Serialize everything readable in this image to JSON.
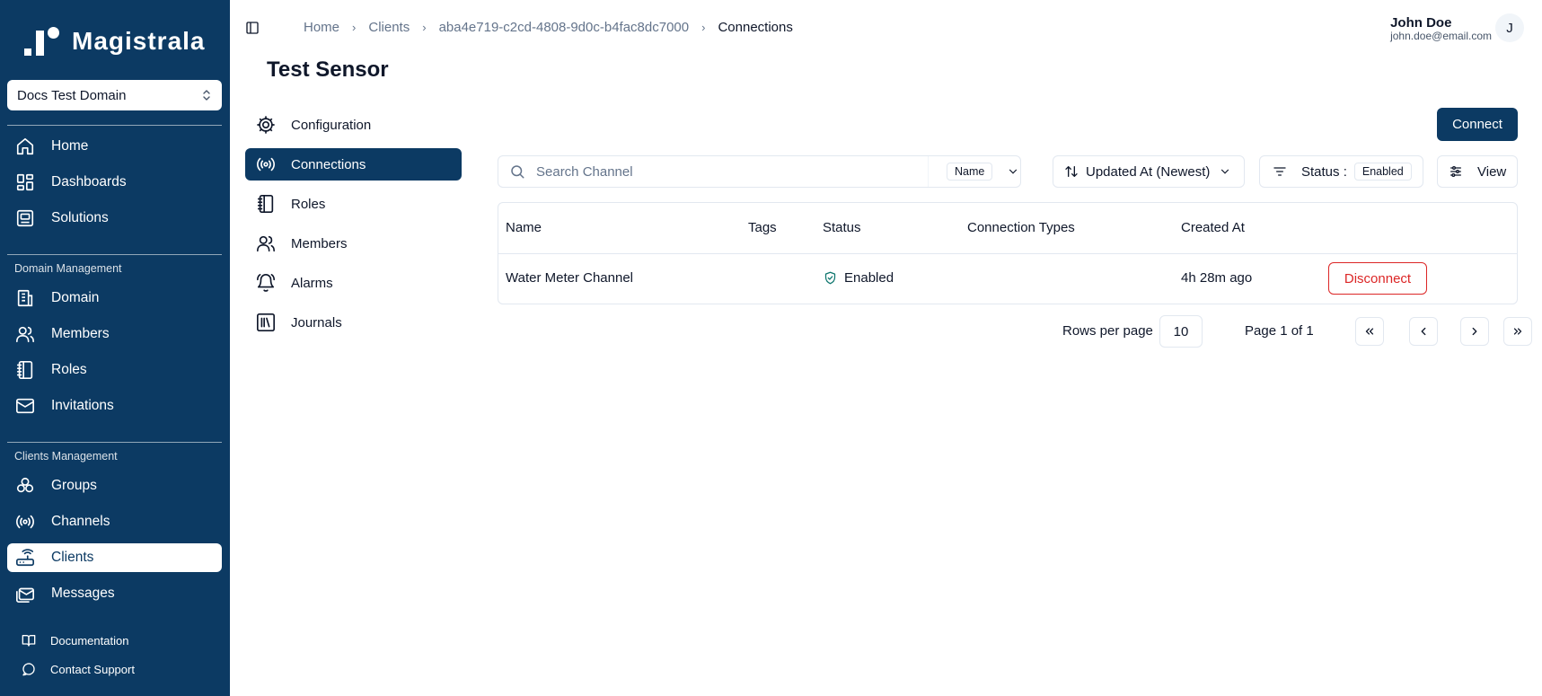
{
  "app": {
    "brand": "Magistrala",
    "domain_selector": "Docs Test Domain"
  },
  "sidebar": {
    "main_items": [
      {
        "label": "Home",
        "icon": "home-icon"
      },
      {
        "label": "Dashboards",
        "icon": "dashboard-icon"
      },
      {
        "label": "Solutions",
        "icon": "solutions-icon"
      }
    ],
    "domain_section_label": "Domain Management",
    "domain_items": [
      {
        "label": "Domain",
        "icon": "building-icon"
      },
      {
        "label": "Members",
        "icon": "users-icon"
      },
      {
        "label": "Roles",
        "icon": "notebook-icon"
      },
      {
        "label": "Invitations",
        "icon": "mail-icon"
      }
    ],
    "clients_section_label": "Clients Management",
    "clients_items": [
      {
        "label": "Groups",
        "icon": "groups-icon"
      },
      {
        "label": "Channels",
        "icon": "radio-icon"
      },
      {
        "label": "Clients",
        "icon": "router-icon",
        "active": true
      },
      {
        "label": "Messages",
        "icon": "messages-icon"
      }
    ],
    "footer_items": [
      {
        "label": "Documentation",
        "icon": "book-icon"
      },
      {
        "label": "Contact Support",
        "icon": "chat-icon"
      }
    ]
  },
  "header": {
    "breadcrumb": [
      "Home",
      "Clients",
      "aba4e719-c2cd-4808-9d0c-b4fac8dc7000",
      "Connections"
    ],
    "user": {
      "name": "John Doe",
      "email": "john.doe@email.com",
      "initial": "J"
    }
  },
  "page": {
    "title": "Test Sensor"
  },
  "subnav": [
    {
      "label": "Configuration",
      "icon": "cog-icon"
    },
    {
      "label": "Connections",
      "icon": "radio-icon",
      "active": true
    },
    {
      "label": "Roles",
      "icon": "notebook-icon"
    },
    {
      "label": "Members",
      "icon": "users-icon"
    },
    {
      "label": "Alarms",
      "icon": "bell-ring-icon"
    },
    {
      "label": "Journals",
      "icon": "library-icon"
    }
  ],
  "toolbar": {
    "connect_label": "Connect",
    "search_placeholder": "Search Channel",
    "search_field": "Name",
    "sort_label": "Updated At (Newest)",
    "status_label": "Status :",
    "status_value": "Enabled",
    "view_label": "View"
  },
  "table": {
    "columns": [
      "Name",
      "Tags",
      "Status",
      "Connection Types",
      "Created At"
    ],
    "rows": [
      {
        "name": "Water Meter Channel",
        "tags": "",
        "status": "Enabled",
        "connection_types": "",
        "created_at": "4h 28m ago",
        "action": "Disconnect"
      }
    ]
  },
  "pagination": {
    "rows_per_page_label": "Rows per page",
    "rows_per_page": "10",
    "page_label": "Page 1 of 1"
  },
  "colors": {
    "primary": "#0c3a63",
    "danger": "#dc2626",
    "success": "#0f766e"
  }
}
